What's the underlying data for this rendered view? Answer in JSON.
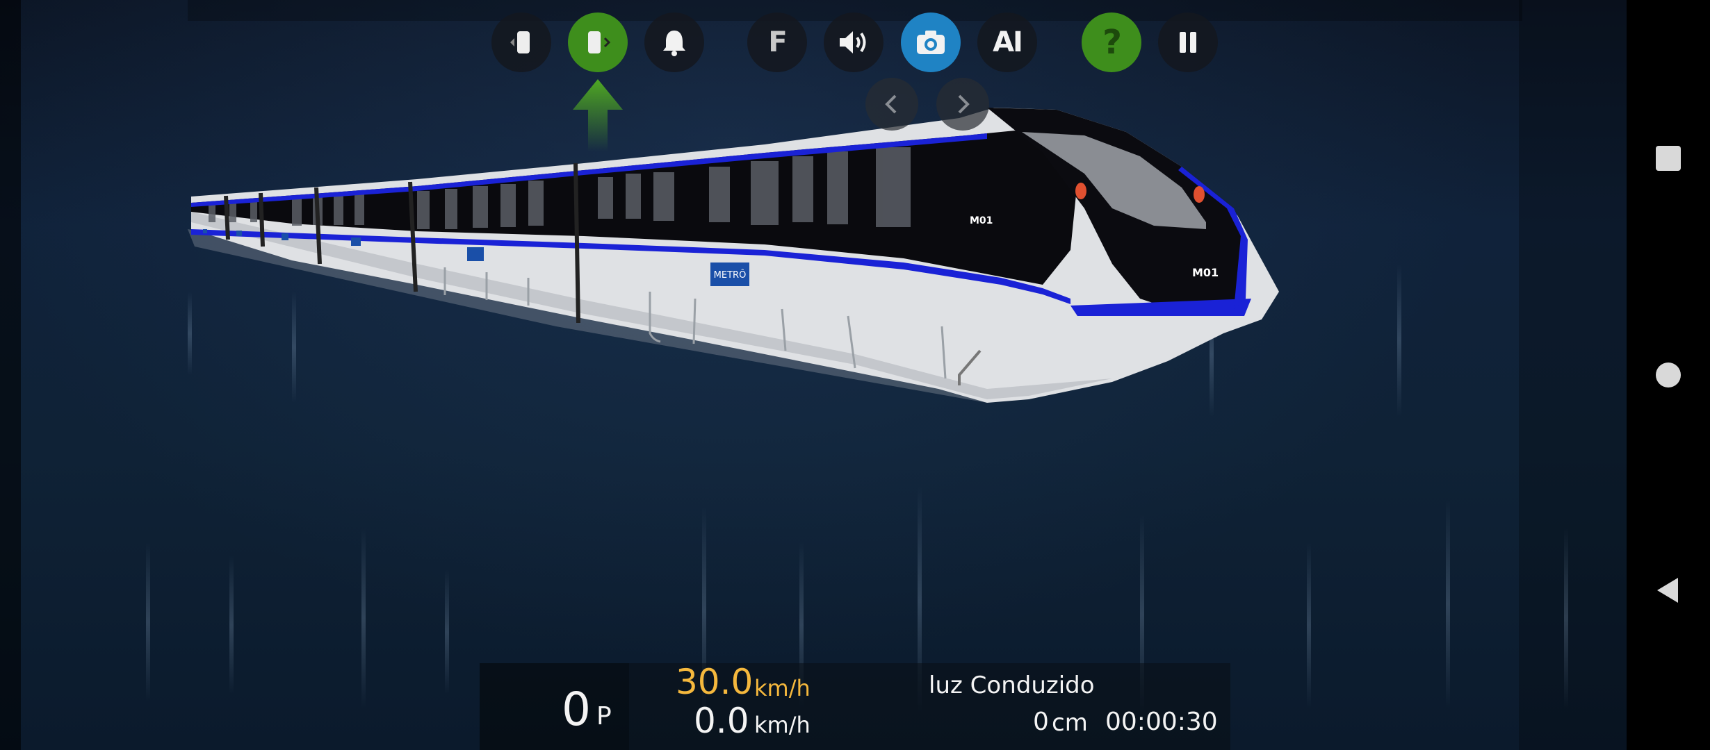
{
  "toolbar": {
    "buttons": [
      {
        "name": "prev-car-view-button",
        "icon": "phone-left-icon",
        "style": "dark"
      },
      {
        "name": "next-car-view-button",
        "icon": "phone-right-icon",
        "style": "green"
      },
      {
        "name": "bell-button",
        "icon": "bell-icon",
        "style": "dark"
      },
      {
        "name": "f-button",
        "label": "F",
        "style": "dark"
      },
      {
        "name": "sound-button",
        "icon": "speaker-icon",
        "style": "dark"
      },
      {
        "name": "camera-button",
        "icon": "camera-icon",
        "style": "blue"
      },
      {
        "name": "ai-button",
        "label": "AI",
        "style": "dark"
      },
      {
        "name": "help-button",
        "label": "?",
        "style": "green"
      },
      {
        "name": "pause-button",
        "icon": "pause-icon",
        "style": "dark"
      }
    ],
    "f_label": "F",
    "ai_label": "AI",
    "help_label": "?"
  },
  "camera_nav": {
    "prev_icon": "chevron-left-icon",
    "next_icon": "chevron-right-icon"
  },
  "train": {
    "front_label": "M01",
    "side_label": "M01",
    "logo_text": "METRÔ"
  },
  "hud": {
    "notch_value": "0",
    "notch_unit": "P",
    "speed_limit": "30.0",
    "speed_limit_unit": "km/h",
    "speed": "0.0",
    "speed_unit": "km/h",
    "status": "luz Conduzido",
    "distance_value": "0",
    "distance_unit": "cm",
    "timer": "00:00:30"
  },
  "colors": {
    "accent_green": "#3e8e1c",
    "accent_blue": "#1f83c4",
    "speed_limit_yellow": "#f5b83d",
    "train_stripe_blue": "#1a22d6"
  },
  "system_nav": {
    "icons": [
      "recents-icon",
      "home-icon",
      "back-icon"
    ]
  }
}
